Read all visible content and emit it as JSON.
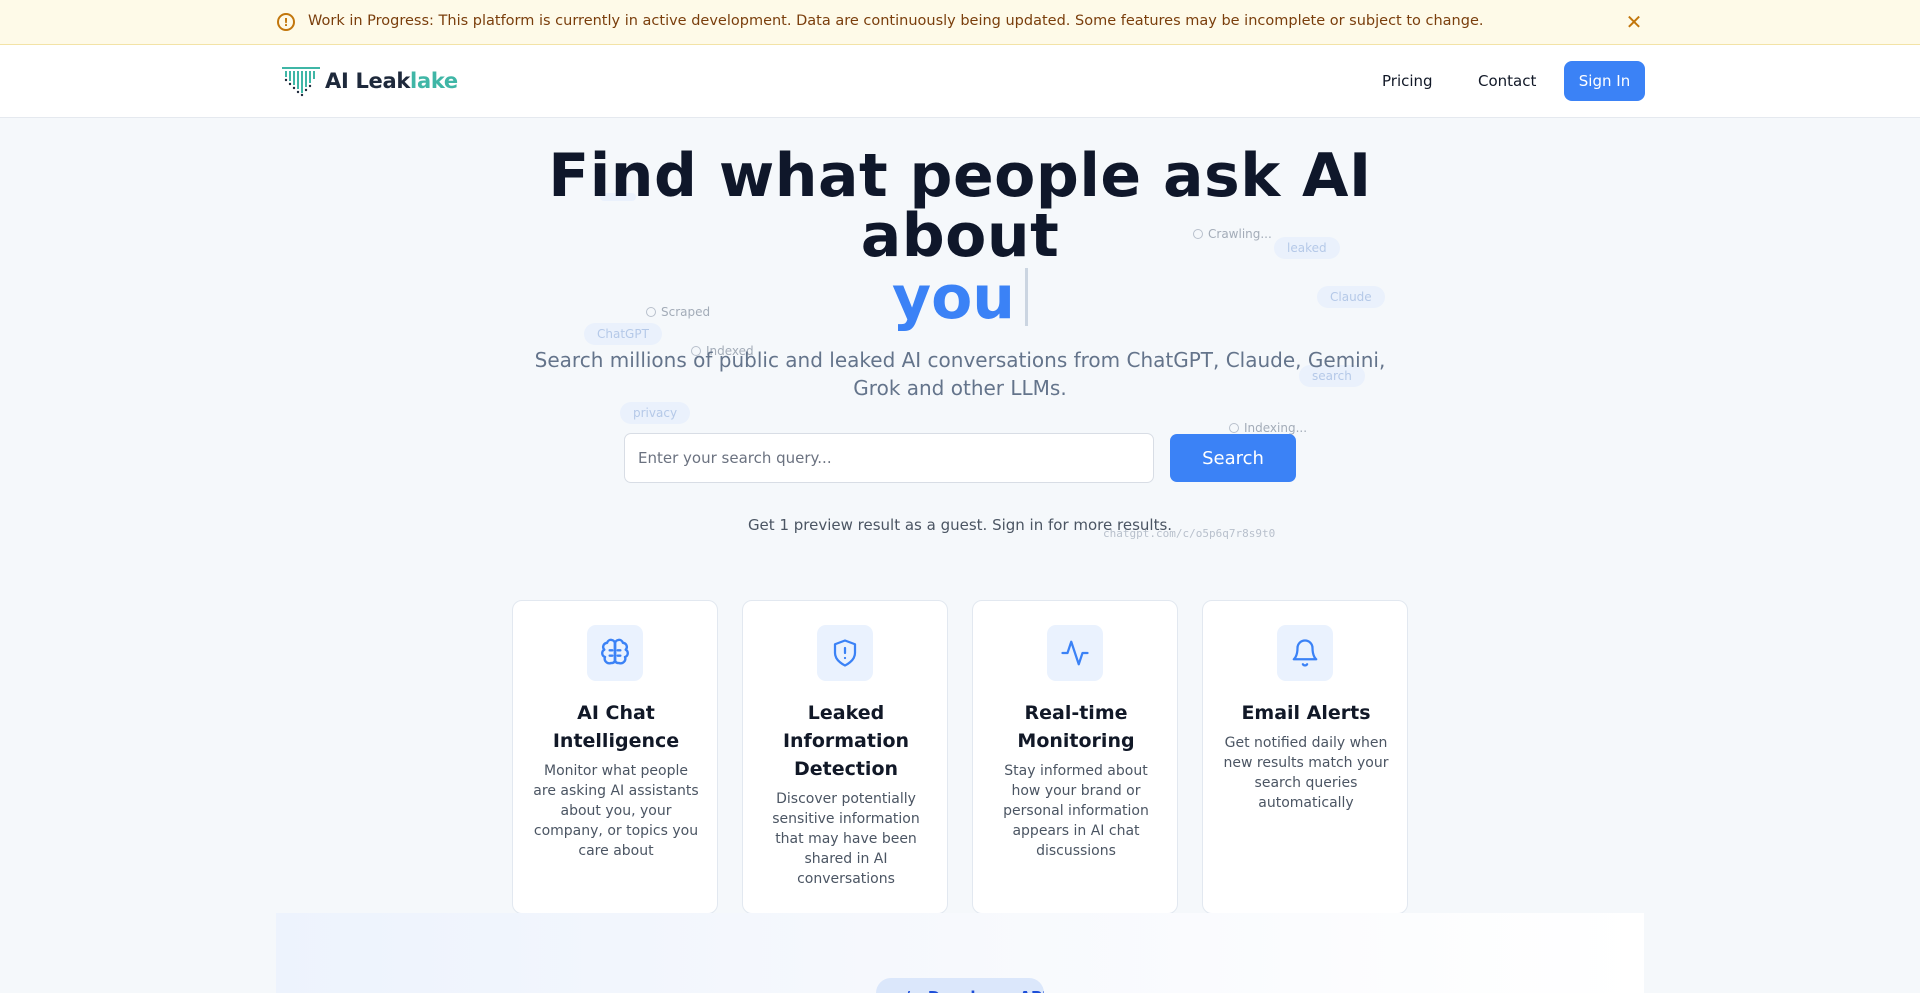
{
  "banner": {
    "text": "Work in Progress: This platform is currently in active development. Data are continuously being updated. Some features may be incomplete or subject to change.",
    "icon": "alert-circle-icon",
    "close_icon": "close-icon"
  },
  "nav": {
    "logo_text_main": "AI Leak",
    "logo_text_accent": "lake",
    "links": [
      "Pricing",
      "Contact"
    ],
    "sign_in": "Sign In"
  },
  "hero": {
    "title": "Find what people ask AI about",
    "highlight": "you",
    "subtitle": "Search millions of public and leaked AI conversations from ChatGPT, Claude, Gemini, Grok and other LLMs."
  },
  "floating": {
    "chips": [
      "leaked",
      "Claude",
      "ChatGPT",
      "privacy",
      "search"
    ],
    "statuses": [
      "Crawling...",
      "Scraped",
      "Indexed",
      "Indexing..."
    ],
    "url": "chatgpt.com/c/o5p6q7r8s9t0"
  },
  "search": {
    "placeholder": "Enter your search query...",
    "button": "Search",
    "guest_note": "Get 1 preview result as a guest. Sign in for more results."
  },
  "features": [
    {
      "icon": "brain-icon",
      "title": "AI Chat Intelligence",
      "description": "Monitor what people are asking AI assistants about you, your company, or topics you care about"
    },
    {
      "icon": "shield-alert-icon",
      "title": "Leaked Information Detection",
      "description": "Discover potentially sensitive information that may have been shared in AI conversations"
    },
    {
      "icon": "activity-icon",
      "title": "Real-time Monitoring",
      "description": "Stay informed about how your brand or personal information appears in AI chat discussions"
    },
    {
      "icon": "bell-icon",
      "title": "Email Alerts",
      "description": "Get notified daily when new results match your search queries automatically"
    }
  ],
  "bottom": {
    "pill": "</> Developer API"
  },
  "colors": {
    "accent": "#3b82f6",
    "banner_bg": "#fefae8",
    "logo_accent": "#3fb6a6"
  }
}
